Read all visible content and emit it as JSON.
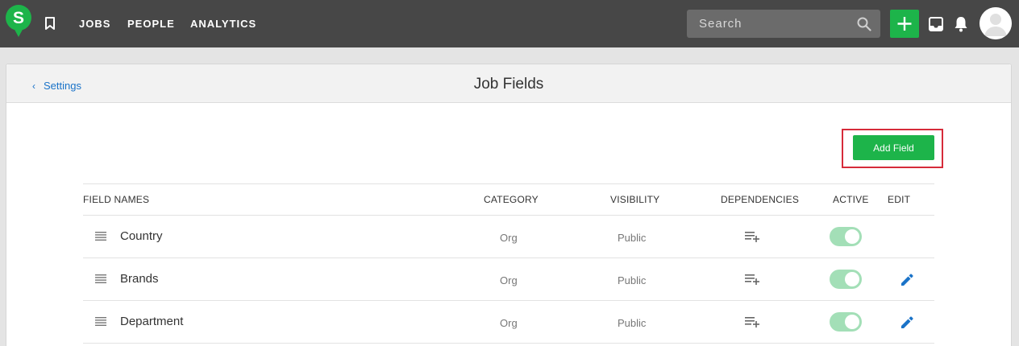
{
  "nav": {
    "logo_letter": "S",
    "links": [
      "JOBS",
      "PEOPLE",
      "ANALYTICS"
    ],
    "search_placeholder": "Search",
    "icons": [
      "bookmark-icon",
      "search-icon",
      "plus-icon",
      "inbox-icon",
      "bell-icon",
      "avatar"
    ]
  },
  "header": {
    "back_label": "Settings",
    "title": "Job Fields"
  },
  "actions": {
    "add_field_label": "Add Field"
  },
  "table": {
    "columns": [
      "FIELD NAMES",
      "CATEGORY",
      "VISIBILITY",
      "DEPENDENCIES",
      "ACTIVE",
      "EDIT"
    ],
    "rows": [
      {
        "name": "Country",
        "category": "Org",
        "visibility": "Public",
        "active": true,
        "editable": false
      },
      {
        "name": "Brands",
        "category": "Org",
        "visibility": "Public",
        "active": true,
        "editable": true
      },
      {
        "name": "Department",
        "category": "Org",
        "visibility": "Public",
        "active": true,
        "editable": true
      }
    ]
  },
  "colors": {
    "navbar": "#474747",
    "brand_green": "#1db44a",
    "toggle_on": "#a3dfb7",
    "link_blue": "#1a73c8",
    "highlight_red": "#d62b3a"
  }
}
